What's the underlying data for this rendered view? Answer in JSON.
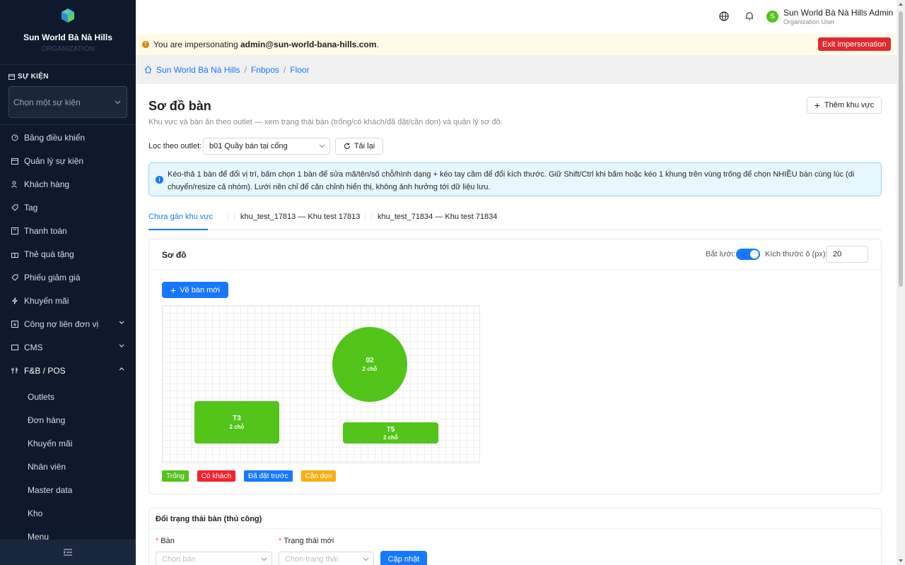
{
  "sidebar": {
    "brand_name": "Sun World Bà Nà Hills",
    "brand_sub": "ORGANIZATION",
    "event_label": "SỰ KIỆN",
    "event_placeholder": "Chọn một sự kiện",
    "items": [
      {
        "label": "Bảng điều khiển",
        "icon": "dashboard-icon"
      },
      {
        "label": "Quản lý sự kiện",
        "icon": "calendar-icon"
      },
      {
        "label": "Khách hàng",
        "icon": "users-icon"
      },
      {
        "label": "Tag",
        "icon": "tag-icon"
      },
      {
        "label": "Thanh toán",
        "icon": "payment-icon"
      },
      {
        "label": "Thẻ quà tặng",
        "icon": "gift-icon"
      },
      {
        "label": "Phiếu giảm giá",
        "icon": "coupon-icon"
      },
      {
        "label": "Khuyến mãi",
        "icon": "promotion-icon"
      },
      {
        "label": "Công nợ liên đơn vị",
        "icon": "debt-icon"
      },
      {
        "label": "CMS",
        "icon": "cms-icon"
      },
      {
        "label": "F&B / POS",
        "icon": "fnb-icon"
      }
    ],
    "fnb_sub": [
      "Outlets",
      "Đơn hàng",
      "Khuyến mãi",
      "Nhân viên",
      "Master data",
      "Kho",
      "Menu"
    ]
  },
  "header": {
    "user_initial": "S",
    "user_name": "Sun World Bà Nà Hills Admin",
    "user_role": "Organization User"
  },
  "impersonation": {
    "prefix": "You are impersonating ",
    "email": "admin@sun-world-bana-hills.com",
    "suffix": ".",
    "exit_label": "Exit impersonation"
  },
  "breadcrumb": [
    "Sun World Bà Nà Hills",
    "Fnbpos",
    "Floor"
  ],
  "page": {
    "title": "Sơ đồ bàn",
    "description": "Khu vực và bàn ăn theo outlet — xem trạng thái bàn (trống/có khách/đã đặt/cần dọn) và quản lý sơ đồ.",
    "add_area_label": "Thêm khu vực",
    "filter_label": "Lọc theo outlet:",
    "filter_value": "b01 Quầy bán tại cổng",
    "reload_label": "Tải lại",
    "info_text": "Kéo-thả 1 bàn để đổi vị trí, bấm chọn 1 bàn để sửa mã/tên/số chỗ/hình dạng + kéo tay cầm để đổi kích thước. Giữ Shift/Ctrl khi bấm hoặc kéo 1 khung trên vùng trống để chọn NHIỀU bàn cùng lúc (di chuyển/resize cả nhóm). Lưới nền chỉ để căn chỉnh hiển thị, không ảnh hưởng tới dữ liệu lưu.",
    "tabs": [
      "Chưa gán khu vực",
      "khu_test_17813 — Khu test 17813",
      "khu_test_71834 — Khu test 71834"
    ]
  },
  "diagram": {
    "title": "Sơ đồ",
    "snap_label": "Bắt lưới:",
    "snap_on": true,
    "cell_label": "Kích thước ô (px):",
    "cell_value": "20",
    "new_table_label": "Vẽ bàn mới",
    "tables": [
      {
        "code": "02",
        "seats": "2 chỗ",
        "shape": "circle",
        "status": "empty"
      },
      {
        "code": "T3",
        "seats": "2 chỗ",
        "shape": "rect",
        "status": "empty"
      },
      {
        "code": "T5",
        "seats": "2 chỗ",
        "shape": "rect",
        "status": "empty"
      }
    ],
    "legend": [
      {
        "label": "Trống",
        "color": "#52c41a"
      },
      {
        "label": "Có khách",
        "color": "#f5222d"
      },
      {
        "label": "Đã đặt trước",
        "color": "#1677ff"
      },
      {
        "label": "Cần dọn",
        "color": "#faad14"
      }
    ]
  },
  "status_form": {
    "title": "Đổi trạng thái bàn (thủ công)",
    "table_label": "Bàn",
    "table_placeholder": "Chọn bàn",
    "status_label": "Trạng thái mới",
    "status_placeholder": "Chọn trạng thái",
    "submit_label": "Cập nhật"
  }
}
